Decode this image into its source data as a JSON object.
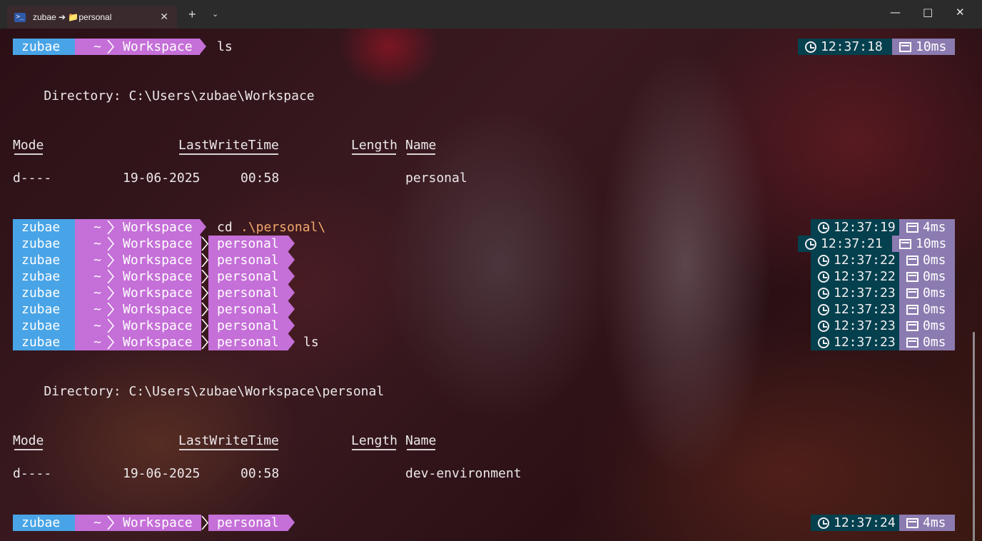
{
  "window": {
    "tab_title": "zubae ➔ 📁personal",
    "tab_icon": "powershell-icon",
    "close_glyph": "✕",
    "new_tab_glyph": "+",
    "dropdown_glyph": "⌄",
    "minimize_glyph": "—",
    "maximize_glyph": "□",
    "window_close_glyph": "✕"
  },
  "prompt": {
    "user": "zubae",
    "home": "~",
    "dir1": "Workspace",
    "dir2": "personal"
  },
  "colors": {
    "user_segment": "#49a4e7",
    "path_segment": "#c56fd8",
    "time_segment": "#04404e",
    "duration_segment": "#8c7bb0",
    "argument_text": "#f0a86a"
  },
  "block1": {
    "command": "ls",
    "time": "12:37:18",
    "duration": "10ms",
    "directory_line": "    Directory: C:\\Users\\zubae\\Workspace",
    "header_mode": "Mode",
    "header_lwt": "LastWriteTime",
    "header_length": "Length",
    "header_name": "Name",
    "row_mode": "d----",
    "row_date": "19-06-2025",
    "row_time": "00:58",
    "row_name": "personal"
  },
  "cd_line": {
    "command": "cd",
    "argument": ".\\personal\\",
    "time": "12:37:19",
    "duration": "4ms"
  },
  "repeat_lines": [
    {
      "time": "12:37:21",
      "duration": "10ms",
      "command": ""
    },
    {
      "time": "12:37:22",
      "duration": "0ms",
      "command": ""
    },
    {
      "time": "12:37:22",
      "duration": "0ms",
      "command": ""
    },
    {
      "time": "12:37:23",
      "duration": "0ms",
      "command": ""
    },
    {
      "time": "12:37:23",
      "duration": "0ms",
      "command": ""
    },
    {
      "time": "12:37:23",
      "duration": "0ms",
      "command": ""
    },
    {
      "time": "12:37:23",
      "duration": "0ms",
      "command": "ls"
    }
  ],
  "block2": {
    "directory_line": "    Directory: C:\\Users\\zubae\\Workspace\\personal",
    "header_mode": "Mode",
    "header_lwt": "LastWriteTime",
    "header_length": "Length",
    "header_name": "Name",
    "row_mode": "d----",
    "row_date": "19-06-2025",
    "row_time": "00:58",
    "row_name": "dev-environment"
  },
  "final_prompt": {
    "time": "12:37:24",
    "duration": "4ms"
  }
}
